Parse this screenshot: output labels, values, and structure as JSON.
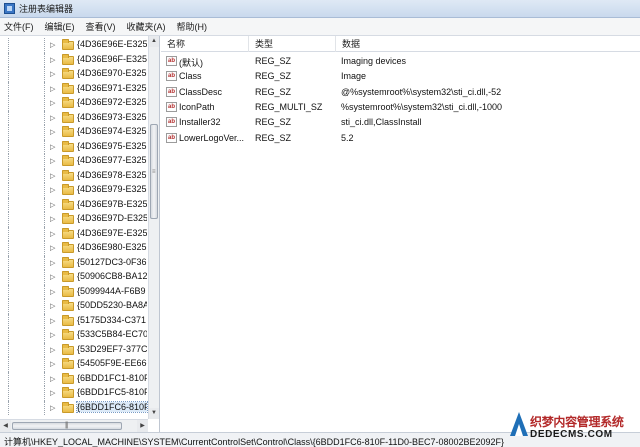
{
  "window": {
    "title": "注册表编辑器"
  },
  "menu": [
    "文件(F)",
    "编辑(E)",
    "查看(V)",
    "收藏夹(A)",
    "帮助(H)"
  ],
  "tree": {
    "items": [
      "{4D36E96E-E325",
      "{4D36E96F-E325",
      "{4D36E970-E325",
      "{4D36E971-E325",
      "{4D36E972-E325",
      "{4D36E973-E325",
      "{4D36E974-E325",
      "{4D36E975-E325",
      "{4D36E977-E325",
      "{4D36E978-E325",
      "{4D36E979-E325",
      "{4D36E97B-E325",
      "{4D36E97D-E325",
      "{4D36E97E-E325",
      "{4D36E980-E325",
      "{50127DC3-0F36",
      "{50906CB8-BA12",
      "{5099944A-F6B9",
      "{50DD5230-BA8A",
      "{5175D334-C371",
      "{533C5B84-EC70",
      "{53D29EF7-377C",
      "{54505F9E-EE66-",
      "{6BDD1FC1-810F",
      "{6BDD1FC5-810F",
      "{6BDD1FC6-810F"
    ],
    "selected_index": 25
  },
  "list": {
    "headers": {
      "name": "名称",
      "type": "类型",
      "data": "数据"
    },
    "rows": [
      {
        "name": "(默认)",
        "type": "REG_SZ",
        "data": "Imaging devices",
        "icon": "ab"
      },
      {
        "name": "Class",
        "type": "REG_SZ",
        "data": "Image",
        "icon": "ab"
      },
      {
        "name": "ClassDesc",
        "type": "REG_SZ",
        "data": "@%systemroot%\\system32\\sti_ci.dll,-52",
        "icon": "ab"
      },
      {
        "name": "IconPath",
        "type": "REG_MULTI_SZ",
        "data": "%systemroot%\\system32\\sti_ci.dll,-1000",
        "icon": "ab"
      },
      {
        "name": "Installer32",
        "type": "REG_SZ",
        "data": "sti_ci.dll,ClassInstall",
        "icon": "ab"
      },
      {
        "name": "LowerLogoVer...",
        "type": "REG_SZ",
        "data": "5.2",
        "icon": "ab"
      }
    ]
  },
  "status": {
    "path": "计算机\\HKEY_LOCAL_MACHINE\\SYSTEM\\CurrentControlSet\\Control\\Class\\{6BDD1FC6-810F-11D0-BEC7-08002BE2092F}"
  },
  "watermark": {
    "line1": "织梦内容管理系统",
    "line2": "DEDECMS.COM"
  },
  "colors": {
    "selection": "#dceaf8",
    "folder": "#e9bb45",
    "watermark_red": "#b32a2a"
  }
}
